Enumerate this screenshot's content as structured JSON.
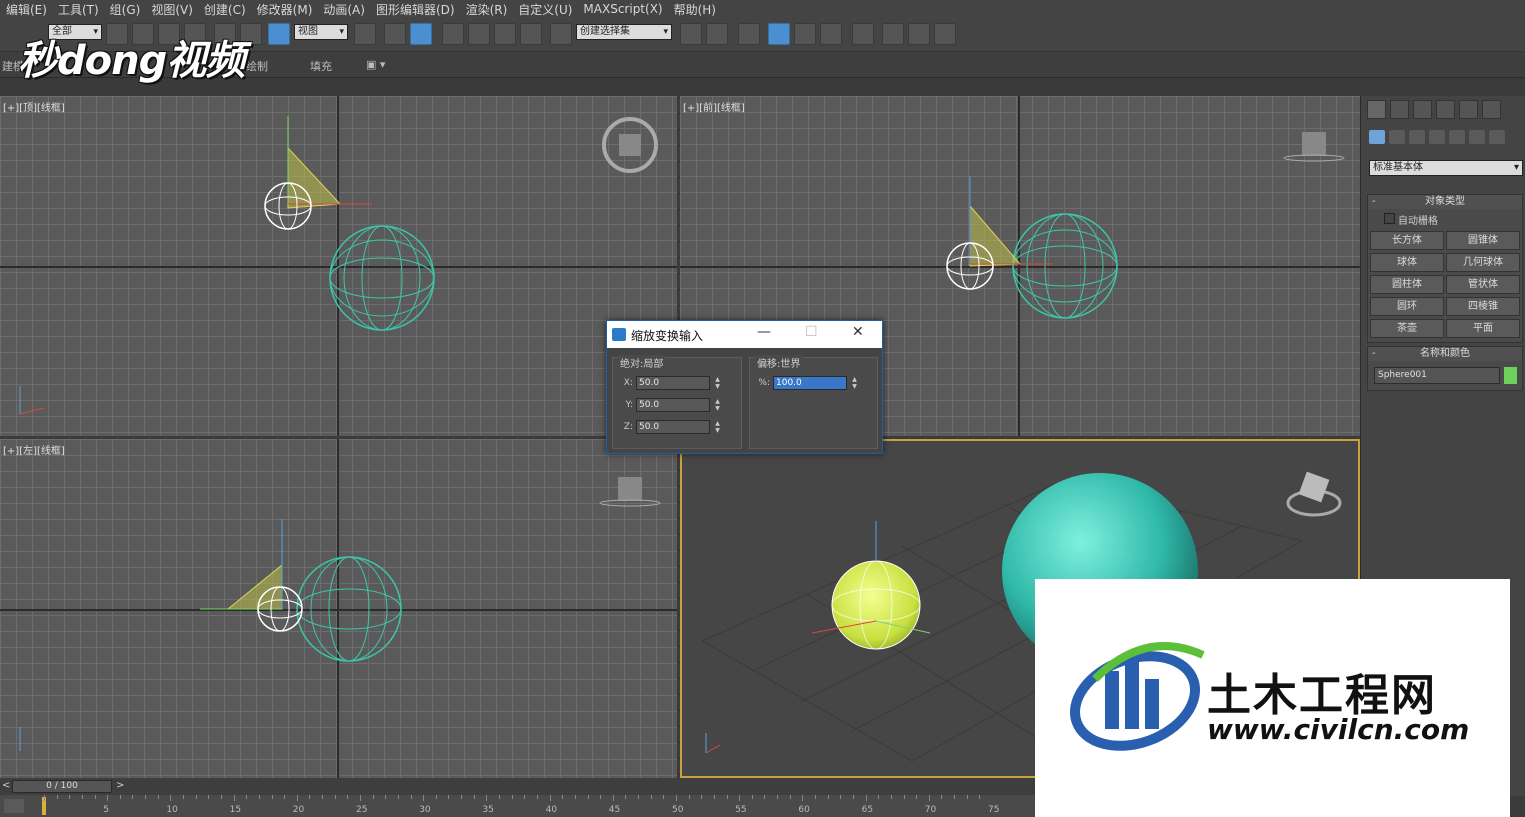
{
  "menu": [
    "编辑(E)",
    "工具(T)",
    "组(G)",
    "视图(V)",
    "创建(C)",
    "修改器(M)",
    "动画(A)",
    "图形编辑器(D)",
    "渲染(R)",
    "自定义(U)",
    "MAXScript(X)",
    "帮助(H)"
  ],
  "toolbar": {
    "filter_value": "全部",
    "view_value": "视图",
    "selset_placeholder": "创建选择集"
  },
  "ribbon": {
    "left_label": "建模",
    "mid_label": "绘制",
    "fill_label": "填充"
  },
  "brand": {
    "text": "秒dong视频"
  },
  "viewports": {
    "top": "[+][顶][线框]",
    "front": "[+][前][线框]",
    "left": "[+][左][线框]"
  },
  "dialog": {
    "title": "缩放变换输入",
    "abs_group": "绝对:局部",
    "offset_group": "偏移:世界",
    "x_label": "X:",
    "x_value": "50.0",
    "y_label": "Y:",
    "y_value": "50.0",
    "z_label": "Z:",
    "z_value": "50.0",
    "pct_label": "%:",
    "pct_value": "100.0"
  },
  "command_panel": {
    "category": "标准基本体",
    "object_type_title": "对象类型",
    "autogrid_label": "自动栅格",
    "objects": [
      "长方体",
      "圆锥体",
      "球体",
      "几何球体",
      "圆柱体",
      "管状体",
      "圆环",
      "四棱锥",
      "茶壶",
      "平面"
    ],
    "name_color_title": "名称和颜色",
    "object_name": "Sphere001",
    "object_color": "#6ed05a"
  },
  "timeline": {
    "slider": "0 / 100",
    "ticks": [
      "5",
      "10",
      "15",
      "20",
      "25",
      "30",
      "35",
      "40",
      "45",
      "50",
      "55",
      "60",
      "65",
      "70",
      "75"
    ]
  },
  "watermark": {
    "title": "土木工程网",
    "url": "www.civilcn.com"
  }
}
